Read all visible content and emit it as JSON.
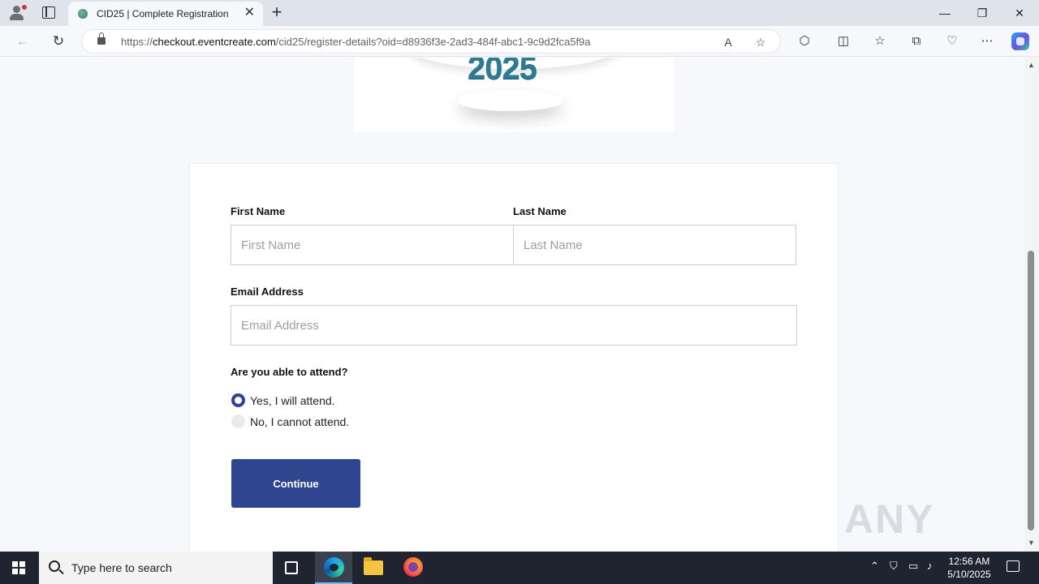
{
  "browser": {
    "tab_title": "CID25 | Complete Registration",
    "tab_close": "✕",
    "new_tab": "+",
    "url_prefix": "https://",
    "url_host": "checkout.eventcreate.com",
    "url_path": "/cid25/register-details?oid=d8936f3e-2ad3-484f-abc1-9c9d2fca5f9a",
    "window_controls": {
      "minimize": "—",
      "restore": "❐",
      "close": "✕"
    }
  },
  "page": {
    "banner_year": "2025",
    "form": {
      "first_name_label": "First Name",
      "first_name_placeholder": "First Name",
      "last_name_label": "Last Name",
      "last_name_placeholder": "Last Name",
      "email_label": "Email Address",
      "email_placeholder": "Email Address",
      "attend_question": "Are you able to attend?",
      "options": [
        {
          "label": "Yes, I will attend.",
          "selected": true
        },
        {
          "label": "No, I cannot attend.",
          "selected": false
        }
      ],
      "continue_label": "Continue"
    },
    "watermark": "ANY RUN"
  },
  "taskbar": {
    "search_placeholder": "Type here to search",
    "time": "12:56 AM",
    "date": "5/10/2025"
  },
  "colors": {
    "accent": "#2f4590",
    "banner_year": "#2c7a93",
    "radio_off": "#e9eaec"
  }
}
